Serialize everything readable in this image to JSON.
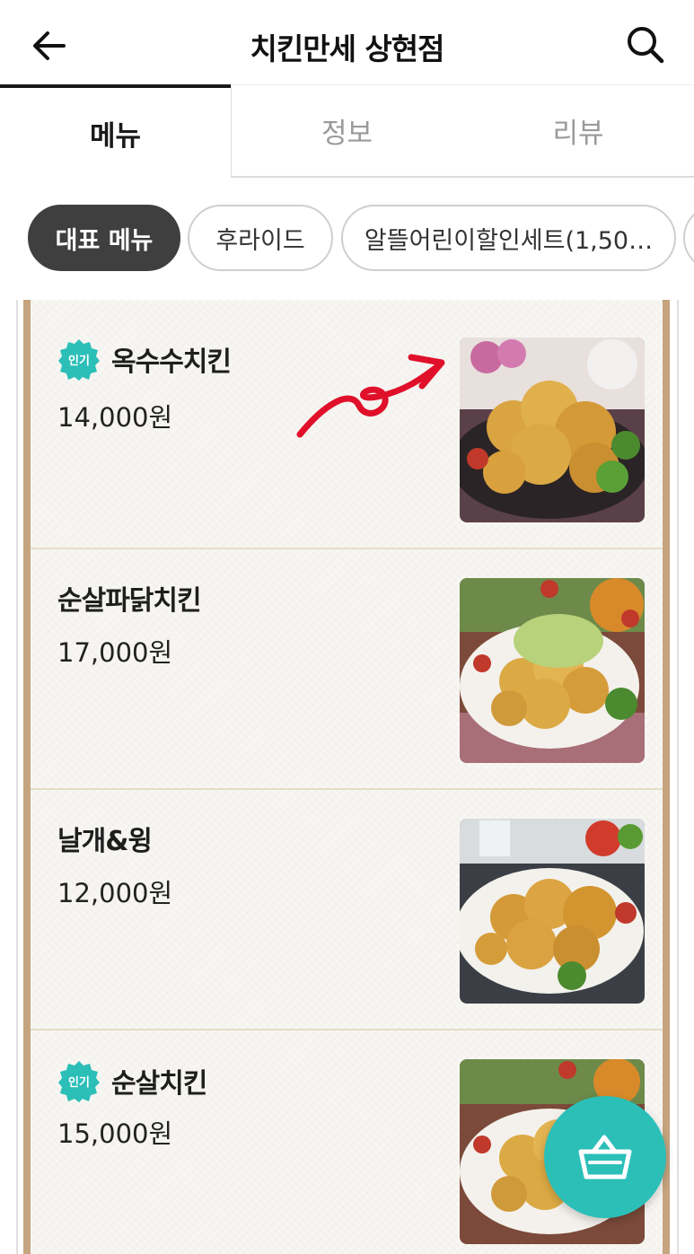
{
  "header": {
    "title": "치킨만세 상현점",
    "back_icon": "arrow-left-icon",
    "search_icon": "search-icon"
  },
  "tabs": [
    {
      "label": "메뉴",
      "active": true
    },
    {
      "label": "정보",
      "active": false
    },
    {
      "label": "리뷰",
      "active": false
    }
  ],
  "categories": [
    {
      "label": "대표 메뉴",
      "active": true
    },
    {
      "label": "후라이드",
      "active": false
    },
    {
      "label": "알뜰어린이할인세트(1,50…",
      "active": false
    },
    {
      "label": "",
      "active": false
    }
  ],
  "badge_label": "인기",
  "menu_items": [
    {
      "name": "옥수수치킨",
      "price": "14,000원",
      "popular": true
    },
    {
      "name": "순살파닭치킨",
      "price": "17,000원",
      "popular": false
    },
    {
      "name": "날개&윙",
      "price": "12,000원",
      "popular": false
    },
    {
      "name": "순살치킨",
      "price": "15,000원",
      "popular": true
    }
  ],
  "cart": {
    "icon": "shopping-basket-icon"
  },
  "colors": {
    "accent": "#2bbfb8",
    "active_chip": "#3f3f3f",
    "frame": "#c5a47f",
    "annotation": "#e0102a"
  }
}
